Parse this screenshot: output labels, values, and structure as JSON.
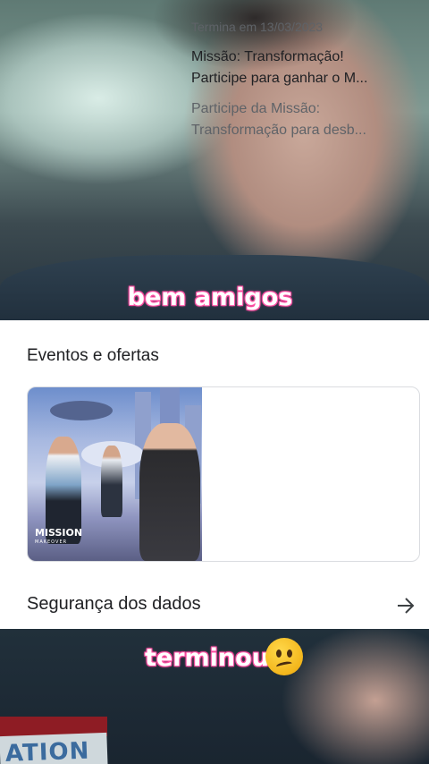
{
  "captions": {
    "top": "bem amigos",
    "bottom": "terminou"
  },
  "events_section": {
    "title": "Eventos e ofertas",
    "event": {
      "date": "Termina em 13/03/2023",
      "title_line1": "Missão: Transformação!",
      "title_line2": "Participe para ganhar o M...",
      "desc_line1": "Participe da Missão:",
      "desc_line2": "Transformação para desb...",
      "image_logo": "MISSION",
      "image_logo_sub": "MAKEOVER"
    }
  },
  "data_safety": {
    "label": "Segurança dos dados",
    "icon": "arrow-right-icon"
  },
  "video_overlay": {
    "badge_text": "ATION",
    "emoji": "confused-face-emoji"
  },
  "colors": {
    "caption_outline": "#ff4fa3",
    "text_primary": "#202124",
    "text_secondary": "#5f6368",
    "card_border": "#dadce0"
  }
}
